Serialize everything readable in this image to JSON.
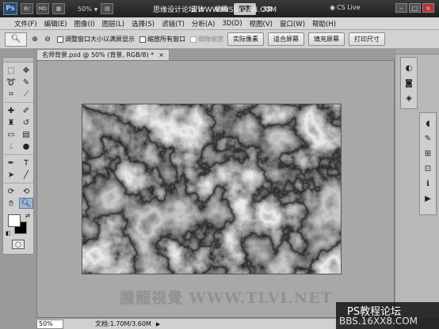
{
  "appbar": {
    "logo": "Ps",
    "buttons": [
      "Br",
      "Mb"
    ],
    "zoom": "50%",
    "workspaces": [
      {
        "label": "设计",
        "active": false
      },
      {
        "label": "绘画",
        "active": false
      },
      {
        "label": "摄影",
        "active": true
      },
      {
        "label": "3D",
        "active": false
      }
    ],
    "overlay_text": "思缘设计论坛 WWW.MISSYUAN.COM",
    "cslive": "CS Live"
  },
  "menus": [
    "文件(F)",
    "编辑(E)",
    "图像(I)",
    "图层(L)",
    "选择(S)",
    "滤镜(T)",
    "分析(A)",
    "3D(D)",
    "视图(V)",
    "窗口(W)",
    "帮助(H)"
  ],
  "options": {
    "checks": [
      {
        "label": "调整窗口大小以满屏显示",
        "disabled": false
      },
      {
        "label": "缩放所有窗口",
        "disabled": false
      },
      {
        "label": "细微缩放",
        "disabled": true
      }
    ],
    "buttons": [
      "实际像素",
      "适合屏幕",
      "填充屏幕",
      "打印尺寸"
    ]
  },
  "document": {
    "tab_title": "名师背景.psd @ 50% (背景, RGB/8) *",
    "close": "×"
  },
  "status": {
    "zoom": "50%",
    "doc_size": "文档:1.70M/3.60M"
  },
  "watermark": "騰龍視覺 WWW.TLVI.NET",
  "forum": {
    "title": "PS教程论坛",
    "url": "BBS.16XX8.COM"
  }
}
